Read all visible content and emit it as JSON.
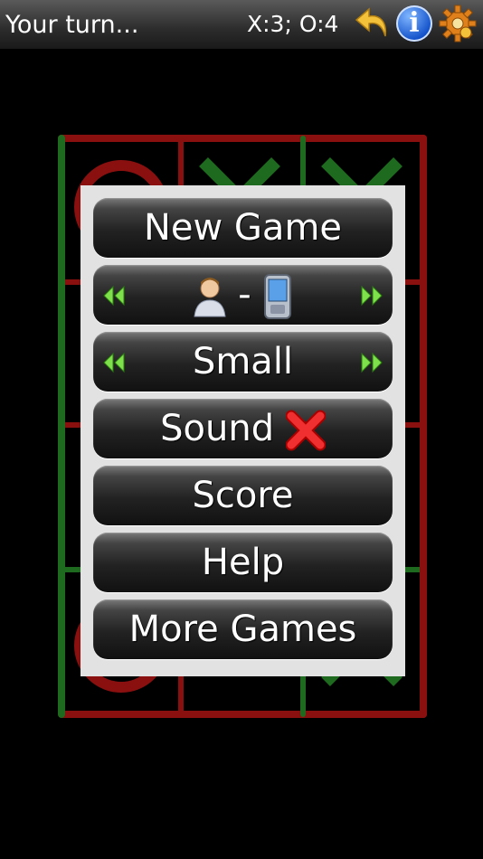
{
  "status": {
    "turn_text": "Your turn...",
    "score_text": "X:3; O:4"
  },
  "menu": {
    "new_game": "New Game",
    "mode_separator": "-",
    "board_size": "Small",
    "sound_label": "Sound",
    "score": "Score",
    "help": "Help",
    "more_games": "More Games"
  },
  "icons": {
    "undo": "undo-arrow-icon",
    "info": "info-icon",
    "settings": "gear-icon",
    "prev": "double-chevron-left-icon",
    "next": "double-chevron-right-icon",
    "player": "person-icon",
    "device": "phone-icon",
    "sound_off": "red-x-icon"
  },
  "info_glyph": "i",
  "colors": {
    "x_mark": "#1e7a1e",
    "o_mark": "#8a1010",
    "grid_red": "#8a1010",
    "grid_green": "#1e6a1e",
    "menu_bg": "#e2e2e2"
  }
}
